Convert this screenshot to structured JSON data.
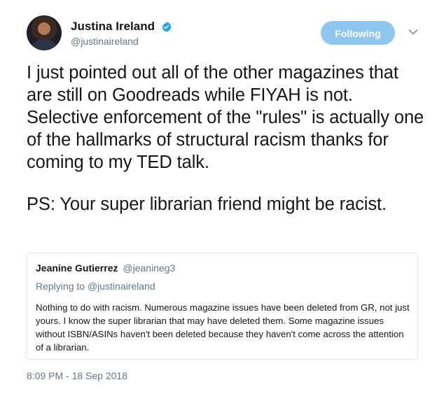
{
  "author": {
    "display_name": "Justina Ireland",
    "handle": "@justinaireland",
    "verified": true
  },
  "follow_button": {
    "label": "Following",
    "color": "#8fc6ef"
  },
  "caret_icon": "chevron-down-icon",
  "tweet": {
    "paragraph_1": "I just pointed out all of the other magazines that are still on Goodreads while FIYAH is not. Selective enforcement of the \"rules\" is actually one of the hallmarks of structural racism thanks for coming to my TED talk.",
    "paragraph_2": "PS: Your super librarian friend might be racist.",
    "timestamp": "8:09 PM - 18 Sep 2018"
  },
  "quoted_tweet": {
    "display_name": "Jeanine Gutierrez",
    "handle": "@jeanineg3",
    "replying_prefix": "Replying to ",
    "replying_to": "@justinaireland",
    "text": "Nothing to do with racism. Numerous magazine issues have been deleted from GR, not just yours. I know the super librarian that may have deleted them. Some magazine issues without ISBN/ASINs haven't been deleted because they haven't come across the attention of a librarian."
  },
  "colors": {
    "text": "#14171a",
    "secondary_text": "#657786",
    "verified_badge": "#1da1f2",
    "border": "#e1e8ed"
  }
}
